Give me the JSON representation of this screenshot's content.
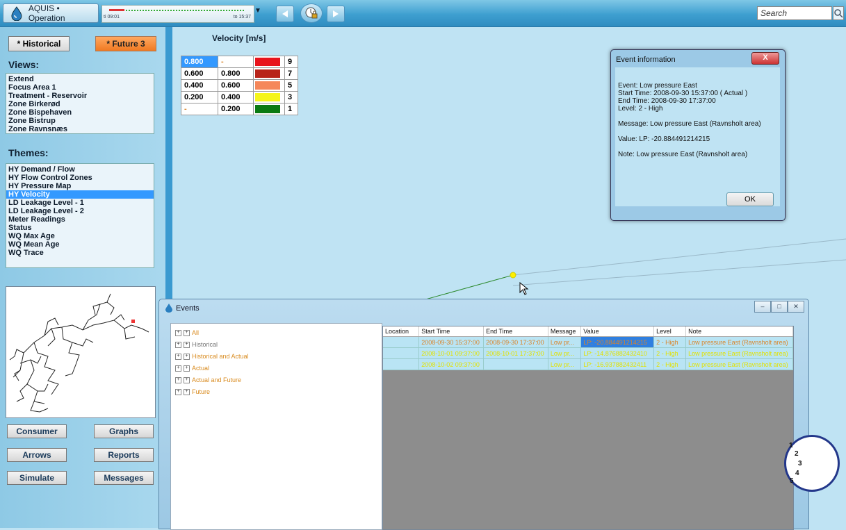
{
  "topbar": {
    "app_title": "AQUIS • Operation",
    "timeline_from": "ti 09:01",
    "timeline_to": "to 15:37",
    "search_placeholder": "Search"
  },
  "left": {
    "historical_label": "* Historical",
    "future_label": "* Future 3",
    "views_title": "Views:",
    "views": [
      "Extend",
      "Focus Area 1",
      "Treatment - Reservoir",
      "Zone Birkerød",
      "Zone Bispehaven",
      "Zone Bistrup",
      "Zone Ravnsnæs"
    ],
    "themes_title": "Themes:",
    "themes": [
      "HY Demand / Flow",
      "HY Flow Control Zones",
      "HY Pressure Map",
      "HY Velocity",
      "LD Leakage Level - 1",
      "LD Leakage Level - 2",
      "Meter Readings",
      "Status",
      "WQ Max Age",
      "WQ Mean Age",
      "WQ Trace"
    ],
    "selected_theme": "HY Velocity",
    "buttons": {
      "consumer": "Consumer",
      "graphs": "Graphs",
      "arrows": "Arrows",
      "reports": "Reports",
      "simulate": "Simulate",
      "messages": "Messages"
    }
  },
  "legend": {
    "title": "Velocity [m/s]",
    "rows": [
      {
        "from": "0.800",
        "to": "-",
        "color": "#e8141c",
        "count": "9"
      },
      {
        "from": "0.600",
        "to": "0.800",
        "color": "#b8241a",
        "count": "7"
      },
      {
        "from": "0.400",
        "to": "0.600",
        "color": "#f5875a",
        "count": "5"
      },
      {
        "from": "0.200",
        "to": "0.400",
        "color": "#f5f51a",
        "count": "3"
      },
      {
        "from": "-",
        "to": "0.200",
        "color": "#0a7a12",
        "count": "1"
      }
    ]
  },
  "event_dialog": {
    "title": "Event information",
    "close_label": "X",
    "event": "Event: Low pressure East",
    "start_time": "Start Time: 2008-09-30 15:37:00 ( Actual )",
    "end_time": "End Time: 2008-09-30 17:37:00",
    "level": "Level: 2 - High",
    "message": "Message: Low pressure East (Ravnsholt area)",
    "value": "Value: LP: -20.884491214215",
    "note": "Note: Low pressure East (Ravnsholt area)",
    "ok_label": "OK"
  },
  "events_window": {
    "title": "Events",
    "tree": [
      {
        "label": "All",
        "style": "orange"
      },
      {
        "label": "Historical",
        "style": "gray"
      },
      {
        "label": "Historical and Actual",
        "style": "orange"
      },
      {
        "label": "Actual",
        "style": "orange"
      },
      {
        "label": "Actual and Future",
        "style": "orange"
      },
      {
        "label": "Future",
        "style": "orange"
      }
    ],
    "columns": [
      "Location",
      "Start Time",
      "End Time",
      "Message",
      "Value",
      "Level",
      "Note"
    ],
    "rows": [
      [
        "",
        "2008-09-30 15:37:00",
        "2008-09-30 17:37:00",
        "Low pr...",
        "LP: -20.884491214215",
        "2 - High",
        "Low pressure East (Ravnsholt area)"
      ],
      [
        "",
        "2008-10-01 09:37:00",
        "2008-10-01 17:37:00",
        "Low pr...",
        "LP: -14.876882432410",
        "2 - High",
        "Low pressure East (Ravnsholt area)"
      ],
      [
        "",
        "2008-10-02 09:37:00",
        "",
        "Low pr...",
        "LP: -16.937882432411",
        "2 - High",
        "Low pressure East (Ravnsholt area)"
      ]
    ]
  },
  "clock": {
    "numbers": [
      "1",
      "2",
      "3",
      "4",
      "5"
    ]
  }
}
